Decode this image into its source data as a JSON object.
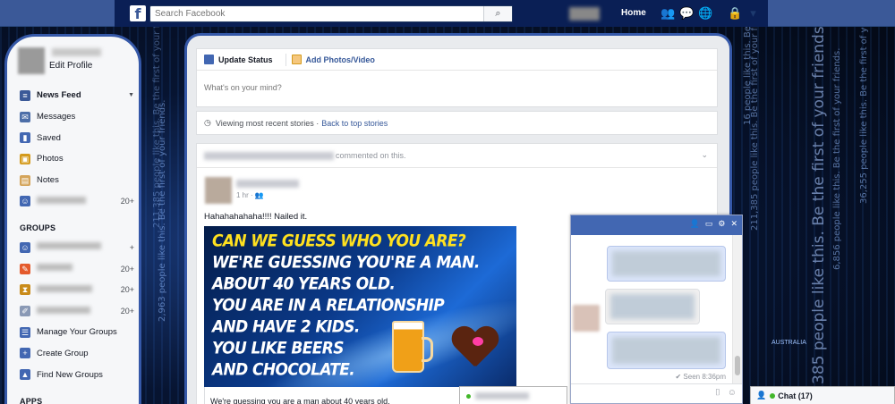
{
  "topbar": {
    "search_placeholder": "Search Facebook",
    "search_icon": "search-icon",
    "home_label": "Home",
    "icons": [
      "friend-requests-icon",
      "messages-icon",
      "notifications-icon",
      "privacy-icon",
      "menu-caret-icon"
    ]
  },
  "sidebar": {
    "edit_profile": "Edit Profile",
    "items": [
      {
        "label": "News Feed",
        "icon": "news-feed-icon",
        "color": "#3b5998",
        "bold": true,
        "extra": "▼"
      },
      {
        "label": "Messages",
        "icon": "messages-icon",
        "color": "#4c6ea8"
      },
      {
        "label": "Saved",
        "icon": "bookmark-icon",
        "color": "#4267b2"
      },
      {
        "label": "Photos",
        "icon": "photos-icon",
        "color": "#d49a1c"
      },
      {
        "label": "Notes",
        "icon": "notes-icon",
        "color": "#d4a45a"
      },
      {
        "label": "",
        "icon": "group-friends-icon",
        "color": "#4267b2",
        "count": "20+",
        "blurred": true
      }
    ],
    "groups_heading": "GROUPS",
    "groups": [
      {
        "icon": "group-icon",
        "color": "#4267b2",
        "count": "+"
      },
      {
        "icon": "pencil-icon",
        "color": "#e45a2c",
        "count": "20+"
      },
      {
        "icon": "hourglass-icon",
        "color": "#c98b1a",
        "count": "20+"
      },
      {
        "icon": "brush-icon",
        "color": "#8a99b5",
        "count": "20+"
      }
    ],
    "group_actions": [
      {
        "label": "Manage Your Groups",
        "icon": "manage-groups-icon",
        "color": "#4267b2"
      },
      {
        "label": "Create Group",
        "icon": "create-group-icon",
        "color": "#4267b2"
      },
      {
        "label": "Find New Groups",
        "icon": "find-groups-icon",
        "color": "#4267b2"
      }
    ],
    "apps_heading": "APPS"
  },
  "composer": {
    "update_status": "Update Status",
    "add_photos": "Add Photos/Video",
    "placeholder": "What's on your mind?"
  },
  "viewing": {
    "text": "Viewing most recent stories ·",
    "link": "Back to top stories"
  },
  "story": {
    "header_suffix": "commented on this.",
    "post_meta": "1 hr · ",
    "post_text": "Hahahahahaha!!!! Nailed it.",
    "promo_lines": [
      "CAN WE GUESS WHO YOU ARE?",
      "WE'RE GUESSING YOU'RE A MAN.",
      "ABOUT 40 YEARS OLD.",
      "YOU ARE IN A RELATIONSHIP",
      "AND HAVE 2 KIDS.",
      "YOU LIKE BEERS",
      "AND CHOCOLATE."
    ],
    "promo_caption": "We're guessing you are a man about 40 years old."
  },
  "chat_window": {
    "seen": "✔ Seen 8:36pm"
  },
  "chat_bar": {
    "label": "Chat (17)"
  },
  "background_text": [
    "2,963 people like this. Be the first of your friends.",
    "211,385 people like this. Be the first of your friends.",
    "16 people like this. Be the first of your friends.",
    "6,856 people like this. Be the first of your friends.",
    "36,255 people like this. Be the first of your friends.",
    "385 people like this. Be the first of your friends.",
    "AUSTRALIA"
  ]
}
